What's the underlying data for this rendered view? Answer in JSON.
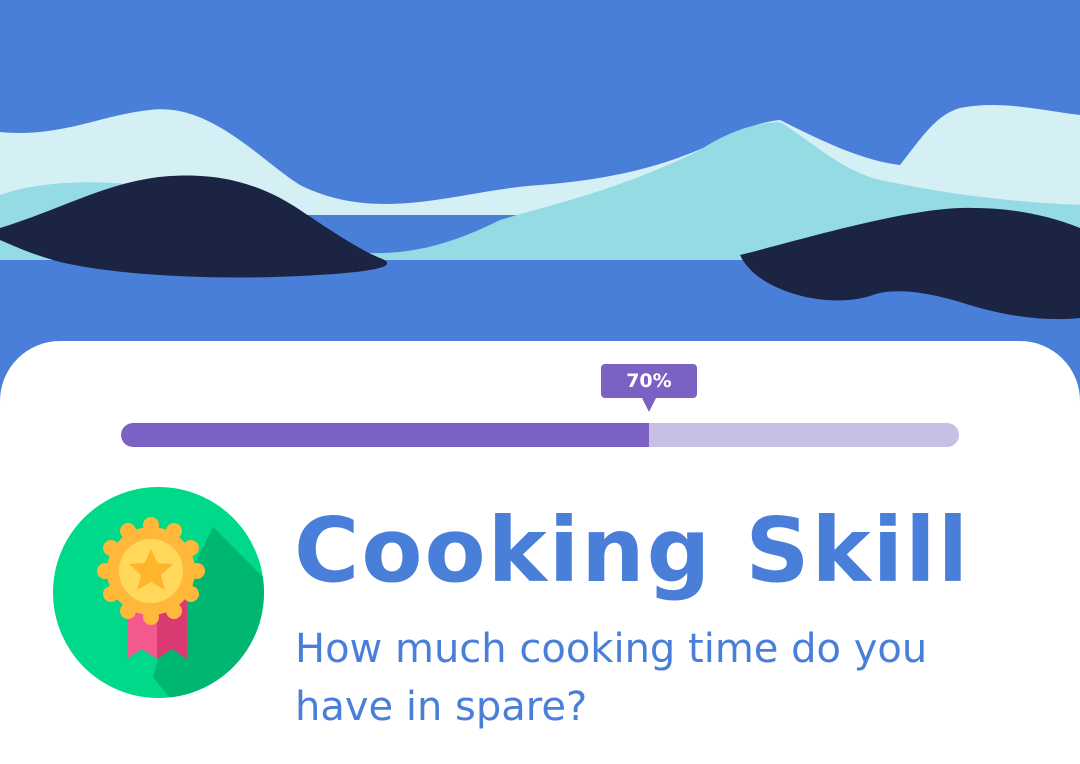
{
  "colors": {
    "sky": "#4a7fd9",
    "wave_light": "#d4f0f4",
    "wave_mid": "#94dbe4",
    "wave_dark": "#1b2442",
    "progress_fill": "#7b61c3",
    "progress_track": "#c8bfe6",
    "badge_circle": "#00d989",
    "medal_gold": "#ffc93c",
    "ribbon_pink": "#f25a8f",
    "text_blue": "#4a7fd9"
  },
  "progress": {
    "value": 0.63,
    "label": "70%"
  },
  "badge": {
    "icon": "medal-star-icon"
  },
  "heading": {
    "title": "Cooking Skill",
    "question": "How much cooking time do you have in spare?"
  }
}
